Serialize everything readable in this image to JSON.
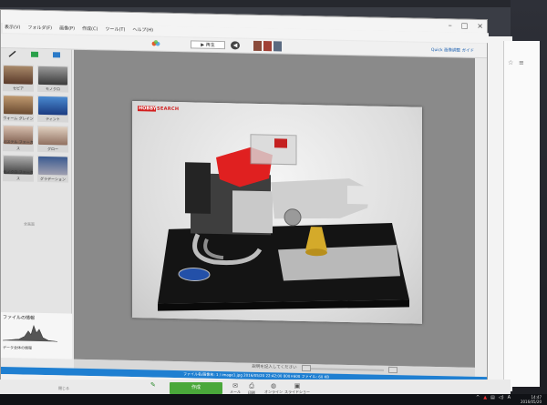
{
  "menu": [
    "表示(V)",
    "フォルダ(F)",
    "画像(P)",
    "作成(C)",
    "ツール(T)",
    "ヘルプ(H)"
  ],
  "toolbar": {
    "play_label": "再生",
    "quick_link": "Quick 画像調整 ガイド"
  },
  "left_panel": {
    "filters": [
      {
        "label": "セピア"
      },
      {
        "label": "モノクロ"
      },
      {
        "label": "ウォーム グレイン"
      },
      {
        "label": "ティント"
      },
      {
        "label": "パステル フォーカス"
      },
      {
        "label": "グロー"
      },
      {
        "label": "モノクロ フォーカス"
      },
      {
        "label": "グラデーション"
      }
    ],
    "sub_label": "全画面",
    "info_title": "ファイルの情報",
    "info_note": "データ全体の情報"
  },
  "photo": {
    "brand_mark": "HOBBY",
    "brand_text": "SEARCH"
  },
  "caption_placeholder": "説明を記入してください",
  "status": {
    "text": "ファイル名/画像名: 1 / image1.jpg 2016/05/20 22:42:00 800×600 ファイル: 60 KB"
  },
  "action_bar": {
    "left_label": "閉じる",
    "create_label": "作成",
    "items": [
      "メール",
      "印刷",
      "オンライン",
      "スライドショー"
    ]
  },
  "tray": {
    "ime": "A",
    "time": "14:47",
    "date": "2016/05/20"
  },
  "colors": {
    "accent_blue": "#1f7fd1",
    "create_green": "#4aa83a",
    "brand_red": "#d21e1e"
  }
}
